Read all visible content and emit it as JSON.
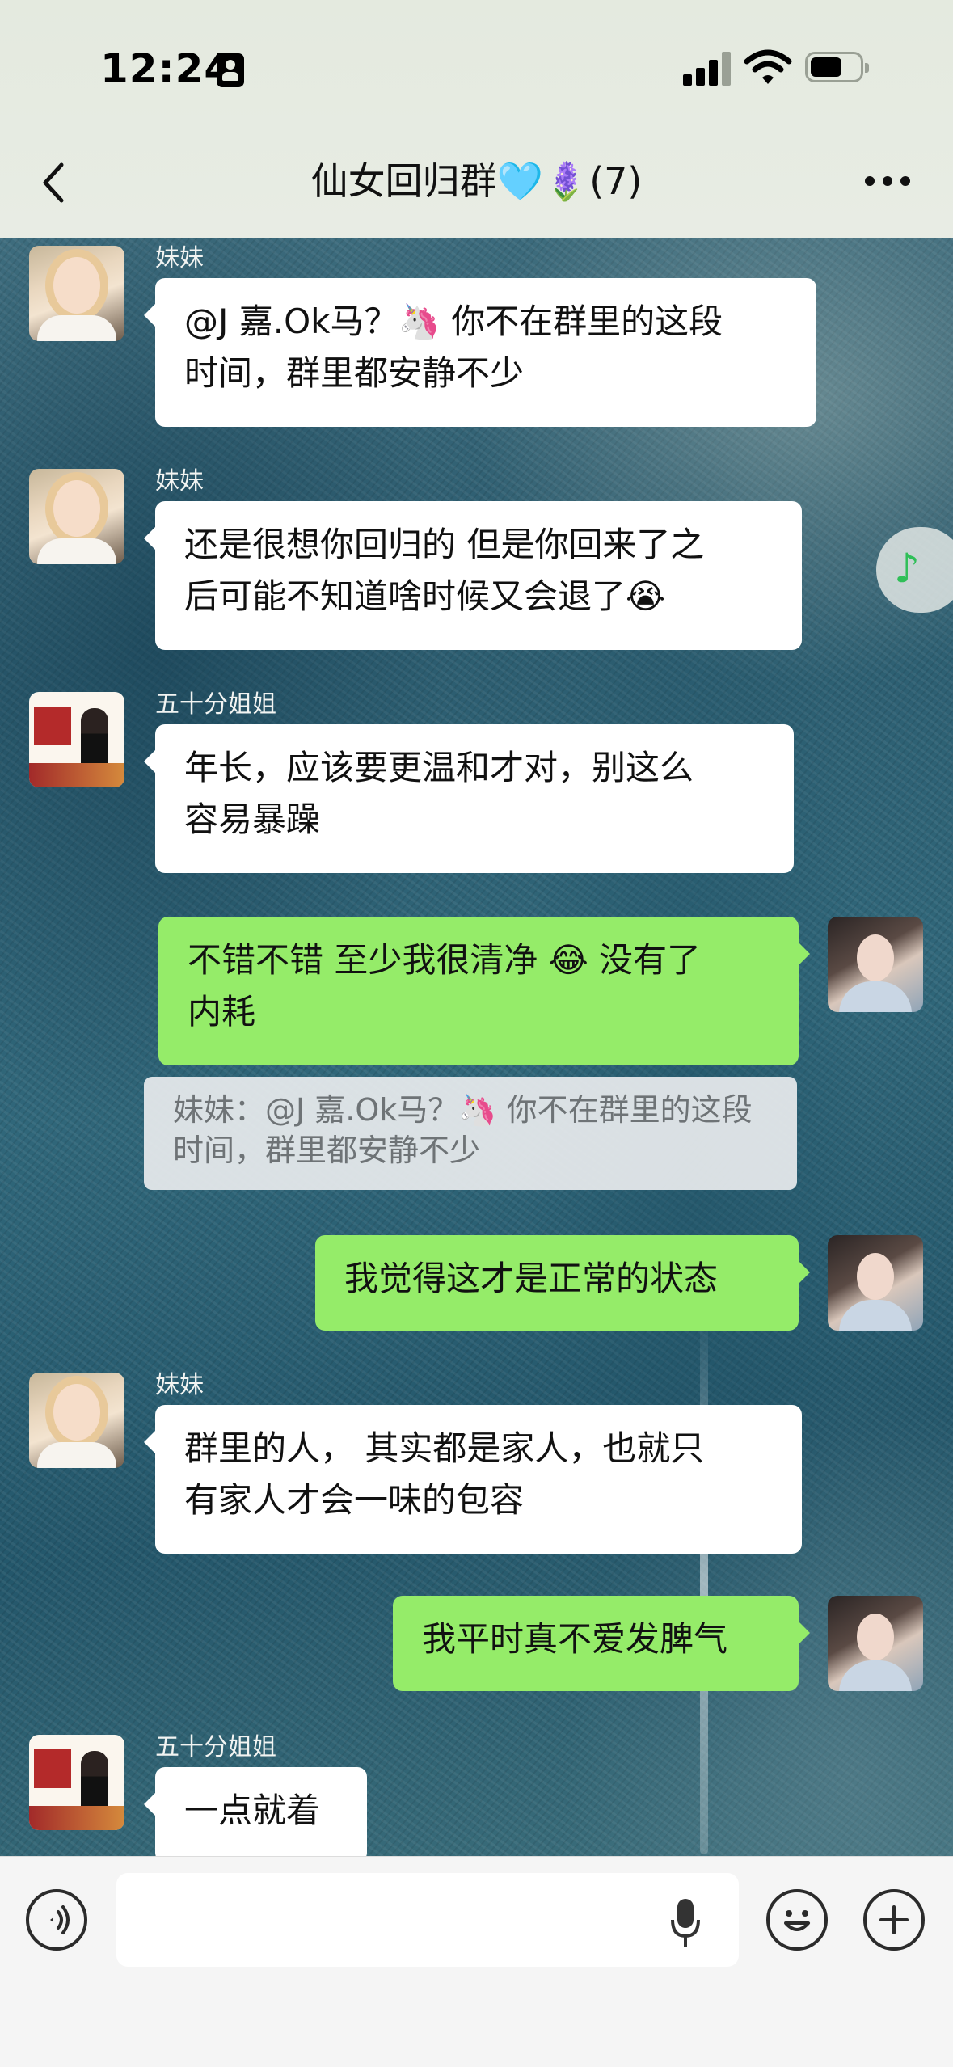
{
  "status": {
    "time": "12:24"
  },
  "nav": {
    "title": "仙女回归群🩵🪻(7)"
  },
  "messages": [
    {
      "sender": "妹妹",
      "text": "@J 嘉.Ok马？🦄 你不在群里的这段\n时间，群里都安静不少"
    },
    {
      "sender": "妹妹",
      "text": "还是很想你回归的 但是你回来了之\n后可能不知道啥时候又会退了😭"
    },
    {
      "sender": "五十分姐姐",
      "text": "年长，应该要更温和才对，别这么\n容易暴躁"
    },
    {
      "sender": "",
      "text": "不错不错 至少我很清净 😂 没有了\n内耗"
    },
    {
      "quote": "妹妹：@J 嘉.Ok马？🦄 你不在群里的这段\n时间，群里都安静不少"
    },
    {
      "sender": "",
      "text": "我觉得这才是正常的状态"
    },
    {
      "sender": "妹妹",
      "text": "群里的人， 其实都是家人，也就只\n有家人才会一味的包容"
    },
    {
      "sender": "",
      "text": "我平时真不爱发脾气"
    },
    {
      "sender": "五十分姐姐",
      "text": "一点就着"
    }
  ],
  "music": {
    "icon": "♪"
  }
}
